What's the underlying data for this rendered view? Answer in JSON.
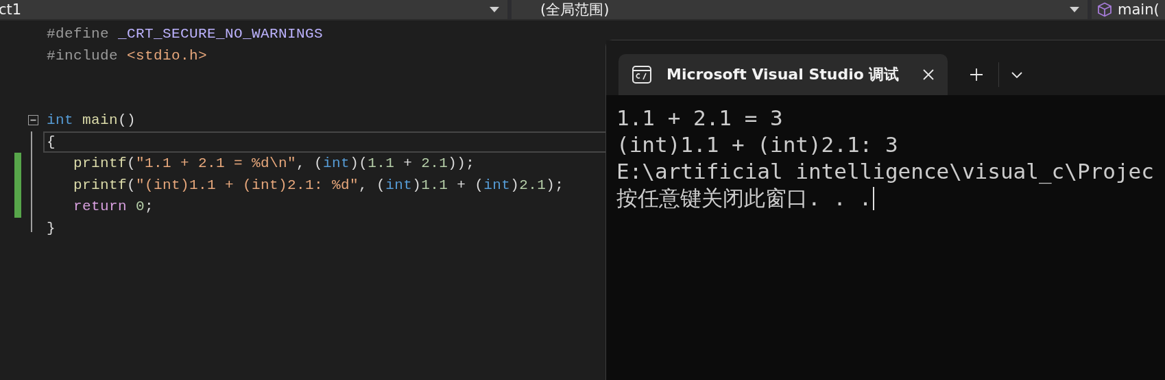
{
  "toolbar": {
    "project_dropdown": {
      "value": "ct1"
    },
    "scope_dropdown": {
      "value": "(全局范围)"
    },
    "member_dropdown": {
      "value": "main("
    }
  },
  "editor": {
    "lines": [
      {
        "kind": "code",
        "modified": false,
        "current": false,
        "tokens": [
          {
            "kind": "preprocessor",
            "text": "#define "
          },
          {
            "kind": "macro",
            "text": "_CRT_SECURE_NO_WARNINGS"
          }
        ]
      },
      {
        "kind": "code",
        "modified": false,
        "current": false,
        "tokens": [
          {
            "kind": "preprocessor",
            "text": "#include "
          },
          {
            "kind": "string",
            "text": "<stdio.h>"
          }
        ]
      },
      {
        "kind": "blank",
        "modified": false,
        "current": false
      },
      {
        "kind": "blank",
        "modified": false,
        "current": false
      },
      {
        "kind": "code",
        "modified": false,
        "current": false,
        "foldable": true,
        "expanded": true,
        "tokens": [
          {
            "kind": "keyword",
            "text": "int"
          },
          {
            "kind": "function",
            "text": " main"
          },
          {
            "kind": "plain",
            "text": "()"
          }
        ]
      },
      {
        "kind": "code",
        "modified": false,
        "current": true,
        "tokens": [
          {
            "kind": "plain",
            "text": "{"
          }
        ]
      },
      {
        "kind": "code",
        "modified": true,
        "current": false,
        "tokens": [
          {
            "kind": "function",
            "text": "   printf"
          },
          {
            "kind": "plain",
            "text": "("
          },
          {
            "kind": "string",
            "text": "\"1.1 + 2.1 = %d\\n\""
          },
          {
            "kind": "plain",
            "text": ", ("
          },
          {
            "kind": "keyword",
            "text": "int"
          },
          {
            "kind": "plain",
            "text": ")("
          },
          {
            "kind": "number",
            "text": "1.1"
          },
          {
            "kind": "plain",
            "text": " + "
          },
          {
            "kind": "number",
            "text": "2.1"
          },
          {
            "kind": "plain",
            "text": "));"
          }
        ]
      },
      {
        "kind": "code",
        "modified": true,
        "current": false,
        "tokens": [
          {
            "kind": "function",
            "text": "   printf"
          },
          {
            "kind": "plain",
            "text": "("
          },
          {
            "kind": "string",
            "text": "\"(int)1.1 + (int)2.1: %d\""
          },
          {
            "kind": "plain",
            "text": ", ("
          },
          {
            "kind": "keyword",
            "text": "int"
          },
          {
            "kind": "plain",
            "text": ")"
          },
          {
            "kind": "number",
            "text": "1.1"
          },
          {
            "kind": "plain",
            "text": " + ("
          },
          {
            "kind": "keyword",
            "text": "int"
          },
          {
            "kind": "plain",
            "text": ")"
          },
          {
            "kind": "number",
            "text": "2.1"
          },
          {
            "kind": "plain",
            "text": ");"
          }
        ]
      },
      {
        "kind": "code",
        "modified": true,
        "current": false,
        "tokens": [
          {
            "kind": "control",
            "text": "   return "
          },
          {
            "kind": "number",
            "text": "0"
          },
          {
            "kind": "plain",
            "text": ";"
          }
        ]
      },
      {
        "kind": "code",
        "modified": false,
        "current": false,
        "tokens": [
          {
            "kind": "plain",
            "text": "}"
          }
        ]
      }
    ]
  },
  "console": {
    "tab": {
      "title": "Microsoft Visual Studio 调试",
      "selected": true
    },
    "output": [
      "1.1 + 2.1 = 3",
      "(int)1.1 + (int)2.1: 3",
      "E:\\artificial intelligence\\visual_c\\Projec",
      "按任意键关闭此窗口. . ."
    ],
    "cursor": true
  }
}
